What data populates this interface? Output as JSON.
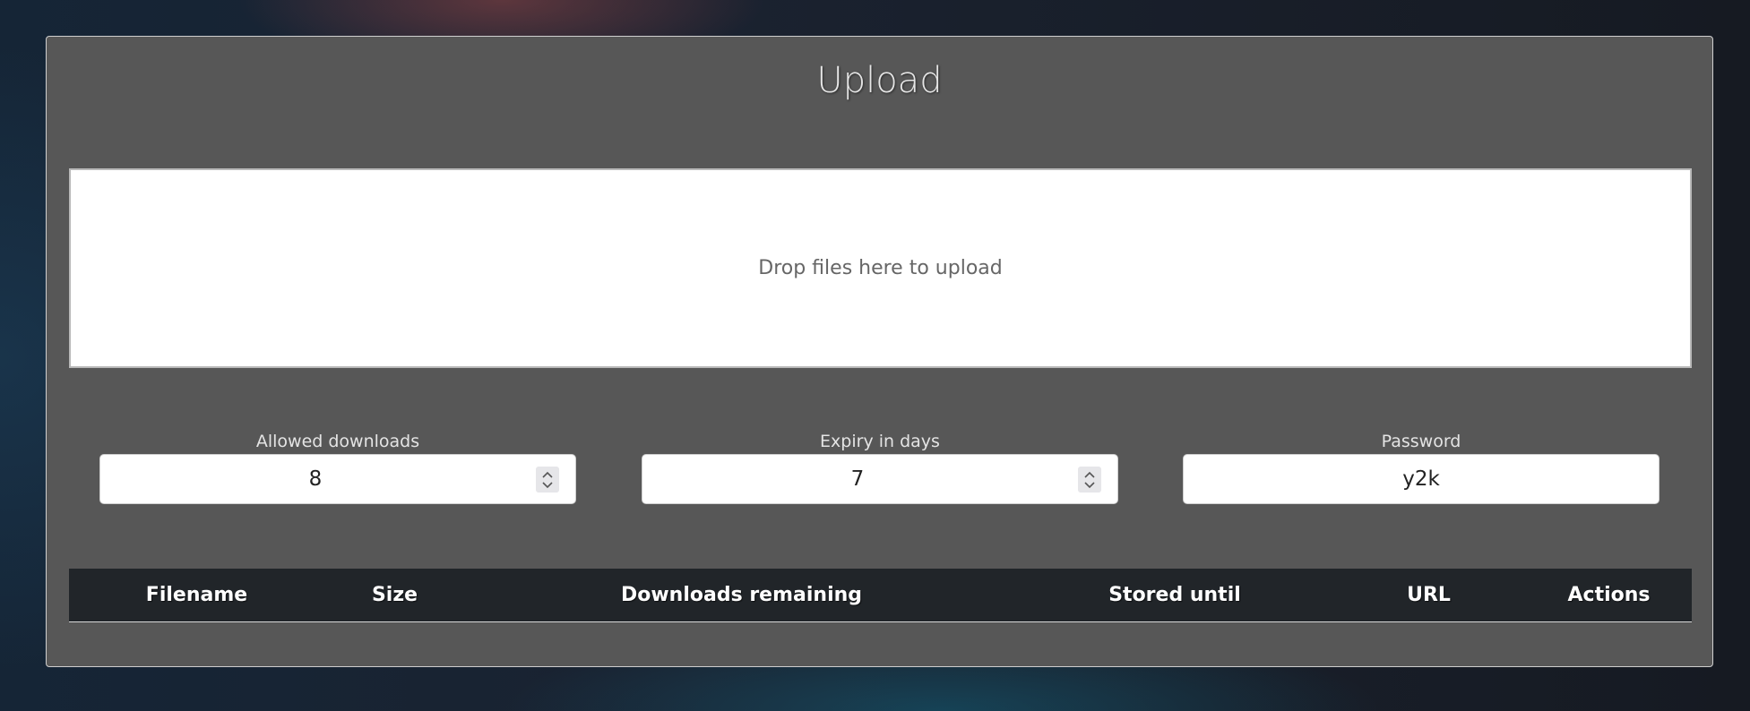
{
  "page": {
    "title": "Upload"
  },
  "dropzone": {
    "message": "Drop files here to upload"
  },
  "settings": {
    "allowed_downloads": {
      "label": "Allowed downloads",
      "value": "8"
    },
    "expiry_days": {
      "label": "Expiry in days",
      "value": "7"
    },
    "password": {
      "label": "Password",
      "value": "y2k"
    }
  },
  "files_table": {
    "columns": [
      "Filename",
      "Size",
      "Downloads remaining",
      "Stored until",
      "URL",
      "Actions"
    ],
    "rows": []
  },
  "colors": {
    "card_background": "#575757",
    "table_header": "#212529"
  }
}
